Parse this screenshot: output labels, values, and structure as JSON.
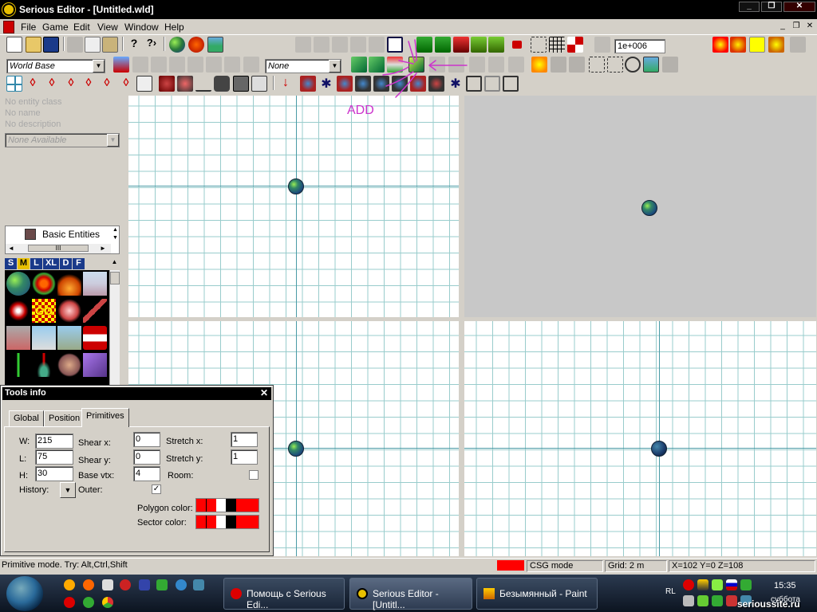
{
  "window": {
    "title": "Serious Editor - [Untitled.wld]"
  },
  "menubar": {
    "items": [
      "File",
      "Game",
      "Edit",
      "View",
      "Window",
      "Help"
    ]
  },
  "toolbar1": {
    "range_value": "1e+006"
  },
  "toolbar2": {
    "layer_combo": "World Base",
    "mode_combo": "None"
  },
  "entity_panel": {
    "class": "No entity class",
    "name": "No name",
    "description": "No description",
    "property_combo": "None Available"
  },
  "tree": {
    "node": "Basic Entities"
  },
  "size_tabs": [
    "S",
    "M",
    "L",
    "XL",
    "D",
    "F"
  ],
  "annotation": {
    "text": "ADD",
    "color": "#cc33cc"
  },
  "tools_info": {
    "title": "Tools info",
    "tabs": [
      "Global",
      "Position",
      "Primitives"
    ],
    "active_tab": "Primitives",
    "w_label": "W:",
    "w_value": "215",
    "l_label": "L:",
    "l_value": "75",
    "h_label": "H:",
    "h_value": "30",
    "history_label": "History:",
    "shear_x_label": "Shear x:",
    "shear_x_value": "0",
    "shear_y_label": "Shear y:",
    "shear_y_value": "0",
    "base_vtx_label": "Base vtx:",
    "base_vtx_value": "4",
    "outer_label": "Outer:",
    "outer_checked": true,
    "stretch_x_label": "Stretch x:",
    "stretch_x_value": "1",
    "stretch_y_label": "Stretch y:",
    "stretch_y_value": "1",
    "room_label": "Room:",
    "room_checked": false,
    "polygon_color_label": "Polygon color:",
    "sector_color_label": "Sector color:",
    "swatch_color": "#ff0000"
  },
  "statusbar": {
    "hint": "Primitive mode. Try: Alt,Ctrl,Shift",
    "csg_indicator_color": "#ff0000",
    "csg": "CSG mode",
    "grid": "Grid: 2 m",
    "coords": "X=102 Y=0 Z=108"
  },
  "taskbar": {
    "tasks": [
      {
        "label": "Помощь с Serious Edi...",
        "active": false
      },
      {
        "label": "Serious Editor - [Untitl...",
        "active": true
      },
      {
        "label": "Безымянный - Paint",
        "active": false
      }
    ],
    "lang": "RL",
    "clock": "15:35",
    "day": "суббота",
    "watermark": "serioussite.ru"
  }
}
